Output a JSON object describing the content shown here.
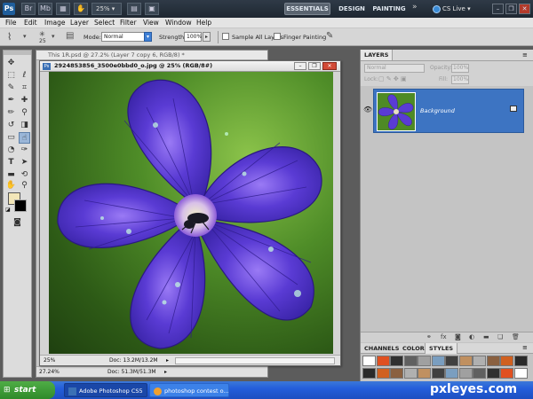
{
  "app": {
    "logo": "Ps",
    "zoom": "25%",
    "workspaces": {
      "essentials": "ESSENTIALS",
      "design": "DESIGN",
      "painting": "PAINTING",
      "more": "»"
    },
    "cs_live": "CS Live"
  },
  "menu": [
    "File",
    "Edit",
    "Image",
    "Layer",
    "Select",
    "Filter",
    "View",
    "Window",
    "Help"
  ],
  "options": {
    "brush_size": "25",
    "mode_label": "Mode:",
    "mode_value": "Normal",
    "strength_label": "Strength:",
    "strength_value": "100%",
    "sample_all": "Sample All Layers",
    "finger": "Finger Painting"
  },
  "back_doc": {
    "title": "This 1R.psd @ 27.2% (Layer 7 copy 6, RGB/8) *",
    "zoom": "27.24%",
    "doc": "Doc: 51.3M/51.3M"
  },
  "front_doc": {
    "title": "2924853856_3500e0bbd0_o.jpg @ 25% (RGB/8#)",
    "zoom": "25%",
    "doc": "Doc: 13.2M/13.2M"
  },
  "layers": {
    "tab": "LAYERS",
    "blend": "Normal",
    "opacity_label": "Opacity:",
    "opacity_value": "100%",
    "lock_label": "Lock:",
    "fill_label": "Fill:",
    "fill_value": "100%",
    "layer_name": "Background"
  },
  "styles_tabs": [
    "CHANNELS",
    "COLOR",
    "STYLES"
  ],
  "taskbar": {
    "start": "start",
    "task1": "Adobe Photoshop CS5",
    "task2": "photoshop contest o..."
  },
  "watermark": "pxleyes.com",
  "colors": {
    "foreground": "#f2e6b8",
    "background": "#000000",
    "flower": "#5a3bd4",
    "selection": "#3d74c2"
  }
}
